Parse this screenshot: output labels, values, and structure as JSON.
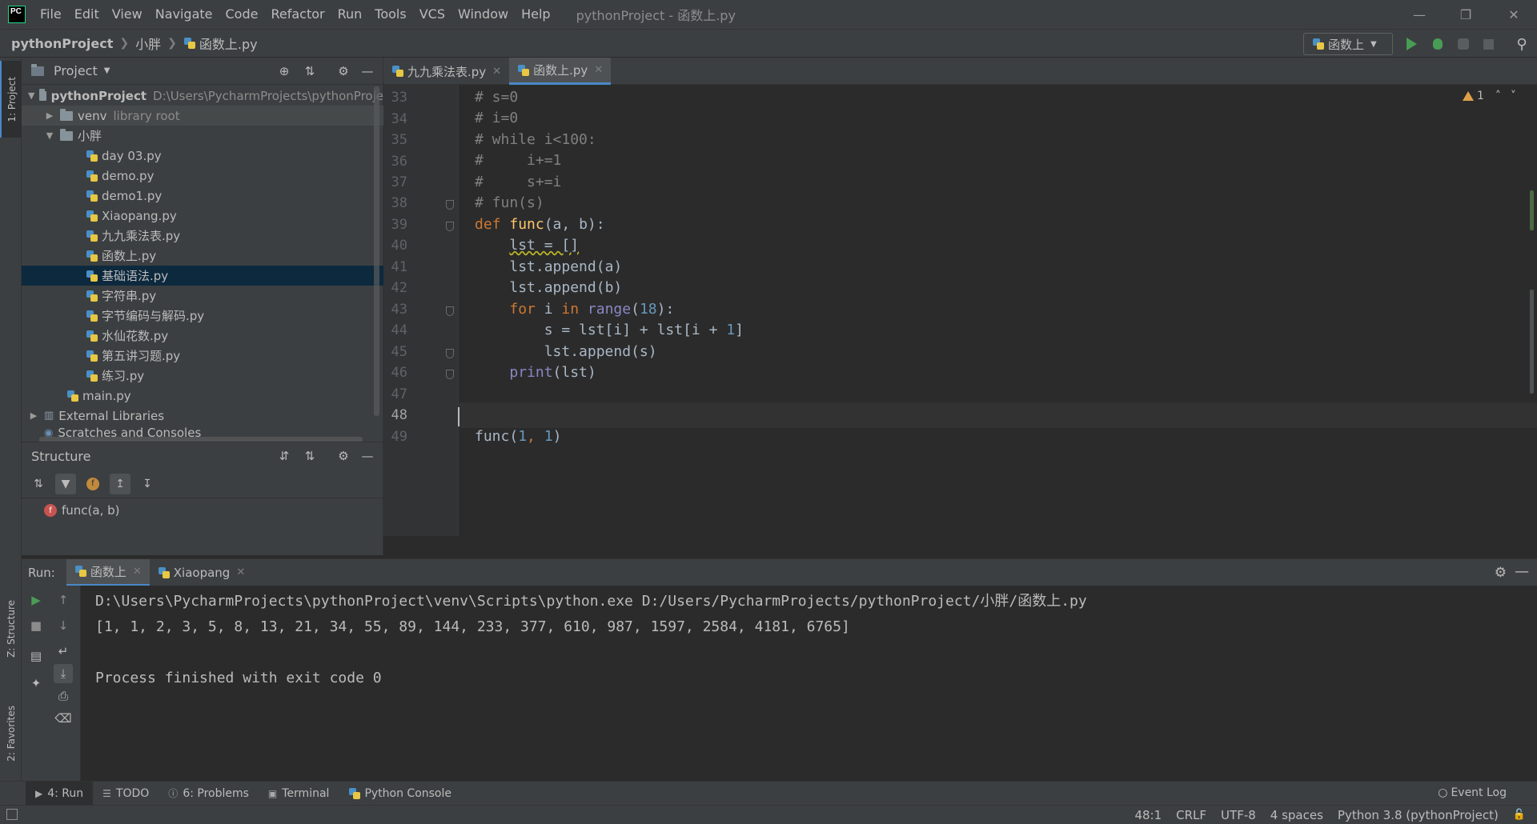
{
  "menubar": {
    "items": [
      "File",
      "Edit",
      "View",
      "Navigate",
      "Code",
      "Refactor",
      "Run",
      "Tools",
      "VCS",
      "Window",
      "Help"
    ],
    "window_title": "pythonProject - 函数上.py"
  },
  "breadcrumb": {
    "project": "pythonProject",
    "folder": "小胖",
    "file": "函数上.py"
  },
  "toolbar": {
    "run_config": "函数上"
  },
  "left_strip": {
    "project_tab": "1: Project",
    "structure_tab": "Z: Structure",
    "favorites_tab": "2: Favorites"
  },
  "project_panel": {
    "title": "Project",
    "root_name": "pythonProject",
    "root_path": "D:\\Users\\PycharmProjects\\pythonProje",
    "venv_name": "venv",
    "venv_note": "library root",
    "folder_name": "小胖",
    "files": [
      "day 03.py",
      "demo.py",
      "demo1.py",
      "Xiaopang.py",
      "九九乘法表.py",
      "函数上.py",
      "基础语法.py",
      "字符串.py",
      "字节编码与解码.py",
      "水仙花数.py",
      "第五讲习题.py",
      "练习.py"
    ],
    "main_file": "main.py",
    "external_libraries": "External Libraries",
    "scratches": "Scratches and Consoles"
  },
  "structure_panel": {
    "title": "Structure",
    "item": "func(a, b)",
    "item_badge": "f"
  },
  "editor_tabs": [
    {
      "label": "九九乘法表.py"
    },
    {
      "label": "函数上.py"
    }
  ],
  "editor": {
    "line_numbers": [
      "33",
      "34",
      "35",
      "36",
      "37",
      "38",
      "39",
      "40",
      "41",
      "42",
      "43",
      "44",
      "45",
      "46",
      "47",
      "48",
      "49"
    ],
    "inspection_count": "1",
    "lines": {
      "l33": "# s=0",
      "l34": "# i=0",
      "l35": "# while i<100:",
      "l36": "#     i+=1",
      "l37": "#     s+=i",
      "l38": "# fun(s)",
      "l39_kw": "def",
      "l39_fn": "func",
      "l39_rest": "(a, b):",
      "l40": "lst = []",
      "l41": "lst.append(a)",
      "l42": "lst.append(b)",
      "l43_kw1": "for",
      "l43_var": " i ",
      "l43_kw2": "in",
      "l43_builtin": "range",
      "l43_open": "(",
      "l43_num": "18",
      "l43_close": "):",
      "l44_a": "s = lst[i] + lst[i + ",
      "l44_num": "1",
      "l44_b": "]",
      "l45": "lst.append(s)",
      "l46_builtin": "print",
      "l46_rest": "(lst)",
      "l49_a": "func(",
      "l49_n1": "1",
      "l49_comma": ", ",
      "l49_n2": "1",
      "l49_b": ")"
    }
  },
  "run_panel": {
    "label": "Run:",
    "tabs": [
      {
        "label": "函数上"
      },
      {
        "label": "Xiaopang"
      }
    ],
    "console": {
      "command": "D:\\Users\\PycharmProjects\\pythonProject\\venv\\Scripts\\python.exe D:/Users/PycharmProjects/pythonProject/小胖/函数上.py",
      "output": "[1, 1, 2, 3, 5, 8, 13, 21, 34, 55, 89, 144, 233, 377, 610, 987, 1597, 2584, 4181, 6765]",
      "blank": "",
      "exit": "Process finished with exit code 0"
    }
  },
  "bottom_tools": {
    "run": "4: Run",
    "todo": "TODO",
    "problems": "6: Problems",
    "terminal": "Terminal",
    "python_console": "Python Console",
    "event_log": "Event Log"
  },
  "statusbar": {
    "position": "48:1",
    "line_sep": "CRLF",
    "encoding": "UTF-8",
    "indent": "4 spaces",
    "interpreter": "Python 3.8 (pythonProject)"
  },
  "colors": {
    "accent": "#4a88c7",
    "run_green": "#499c54",
    "keyword": "#cc7832",
    "function": "#ffc66d",
    "number": "#6897bb",
    "comment": "#808080"
  }
}
